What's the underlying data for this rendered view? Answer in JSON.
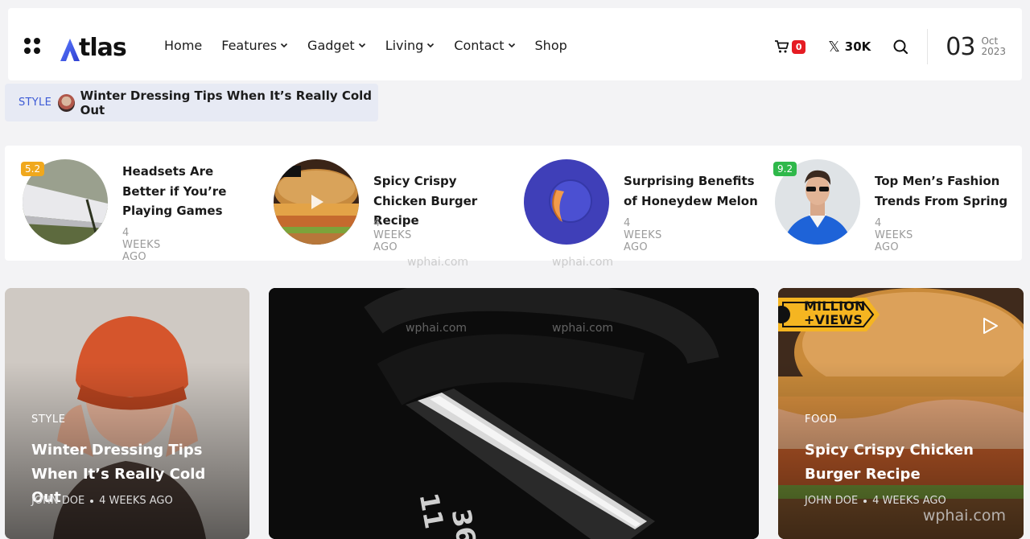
{
  "header": {
    "logo_text": "tlas",
    "logo_accent": "#3d5bd6",
    "nav": [
      {
        "label": "Home",
        "has_dropdown": false
      },
      {
        "label": "Features",
        "has_dropdown": true
      },
      {
        "label": "Gadget",
        "has_dropdown": true
      },
      {
        "label": "Living",
        "has_dropdown": true
      },
      {
        "label": "Contact",
        "has_dropdown": true
      },
      {
        "label": "Shop",
        "has_dropdown": false
      }
    ],
    "cart_count": "0",
    "social_count": "30K",
    "date_day": "03",
    "date_month": "Oct",
    "date_year": "2023"
  },
  "ticker": {
    "tag": "STYLE",
    "headline": "Winter Dressing Tips When It’s Really Cold Out"
  },
  "mini_posts": [
    {
      "title": "Headsets Are Better if You’re Playing Games",
      "meta": "4 WEEKS AGO",
      "score": "5.2",
      "score_color": "#f0a81d"
    },
    {
      "title": "Spicy Crispy Chicken Burger Recipe",
      "meta": "4 WEEKS AGO",
      "score": "",
      "has_video": true
    },
    {
      "title": "Surprising Benefits of Honeydew Melon",
      "meta": "4 WEEKS AGO",
      "score": ""
    },
    {
      "title": "Top Men’s Fashion Trends From Spring",
      "meta": "4 WEEKS AGO",
      "score": "9.2",
      "score_color": "#2fb84a"
    }
  ],
  "cards": [
    {
      "category": "STYLE",
      "title": "Winter Dressing Tips When It’s Really Cold Out",
      "author": "JOHN DOE",
      "time": "4 WEEKS AGO"
    },
    {
      "category": "",
      "title": "",
      "author": "",
      "time": ""
    },
    {
      "category": "FOOD",
      "title": "Spicy Crispy Chicken Burger Recipe",
      "author": "JOHN DOE",
      "time": "4 WEEKS AGO",
      "badge_line1": "MILLION",
      "badge_line2": "+VIEWS"
    }
  ],
  "watermark": "wphai.com"
}
